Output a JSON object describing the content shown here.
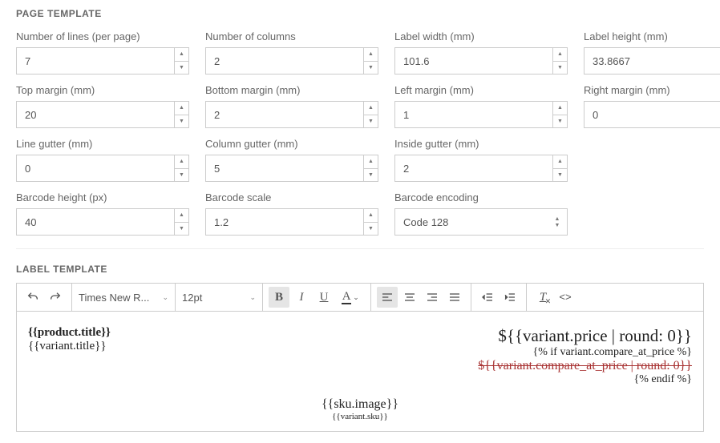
{
  "sections": {
    "page_template": "PAGE TEMPLATE",
    "label_template": "LABEL TEMPLATE"
  },
  "fields": {
    "lines": {
      "label": "Number of lines (per page)",
      "value": "7"
    },
    "cols": {
      "label": "Number of columns",
      "value": "2"
    },
    "lw": {
      "label": "Label width (mm)",
      "value": "101.6"
    },
    "lh": {
      "label": "Label height (mm)",
      "value": "33.8667"
    },
    "tm": {
      "label": "Top margin (mm)",
      "value": "20"
    },
    "bm": {
      "label": "Bottom margin (mm)",
      "value": "2"
    },
    "leftm": {
      "label": "Left margin (mm)",
      "value": "1"
    },
    "rm": {
      "label": "Right margin (mm)",
      "value": "0"
    },
    "lg": {
      "label": "Line gutter (mm)",
      "value": "0"
    },
    "cg": {
      "label": "Column gutter (mm)",
      "value": "5"
    },
    "ig": {
      "label": "Inside gutter (mm)",
      "value": "2"
    },
    "bh": {
      "label": "Barcode height (px)",
      "value": "40"
    },
    "bs": {
      "label": "Barcode scale",
      "value": "1.2"
    },
    "be": {
      "label": "Barcode encoding",
      "value": "Code 128"
    }
  },
  "toolbar": {
    "font": "Times New R...",
    "size": "12pt"
  },
  "editor": {
    "product_title": "{{product.title}}",
    "variant_title": "{{variant.title}}",
    "price": "${{variant.price | round: 0}}",
    "if_cmp": "{% if variant.compare_at_price %}",
    "cmp_price": "${{variant.compare_at_price | round: 0}}",
    "endif": "{% endif %}",
    "sku_image": "{{sku.image}}",
    "variant_sku": "{{variant.sku}}"
  }
}
